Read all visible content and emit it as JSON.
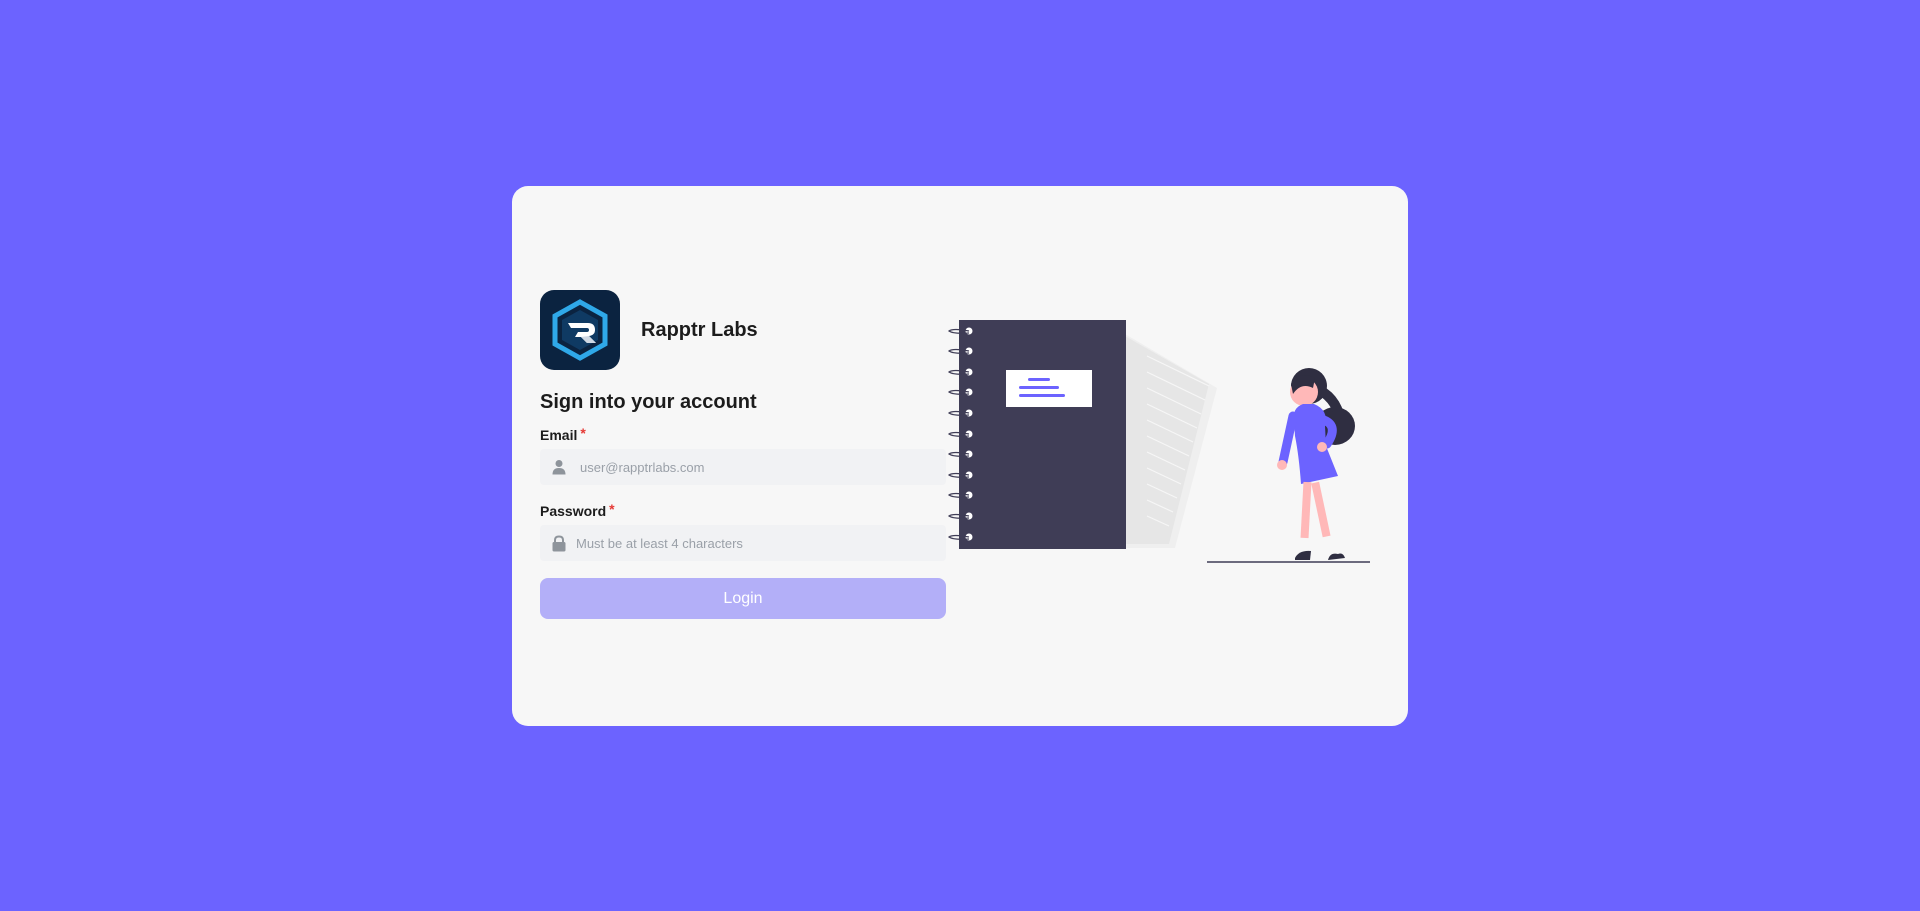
{
  "brand": {
    "name": "Rapptr Labs"
  },
  "form": {
    "heading": "Sign into your account",
    "email": {
      "label": "Email",
      "required_mark": "*",
      "value": "",
      "placeholder": "user@rapptrlabs.com",
      "icon": "user-icon"
    },
    "password": {
      "label": "Password",
      "required_mark": "*",
      "value": "",
      "placeholder": "Must be at least 4 characters",
      "icon": "lock-icon"
    },
    "submit_label": "Login"
  },
  "colors": {
    "background": "#6c63ff",
    "card": "#f7f7f7",
    "button": "#b3aff8",
    "required": "#e53935",
    "notebook": "#3f3d56"
  }
}
